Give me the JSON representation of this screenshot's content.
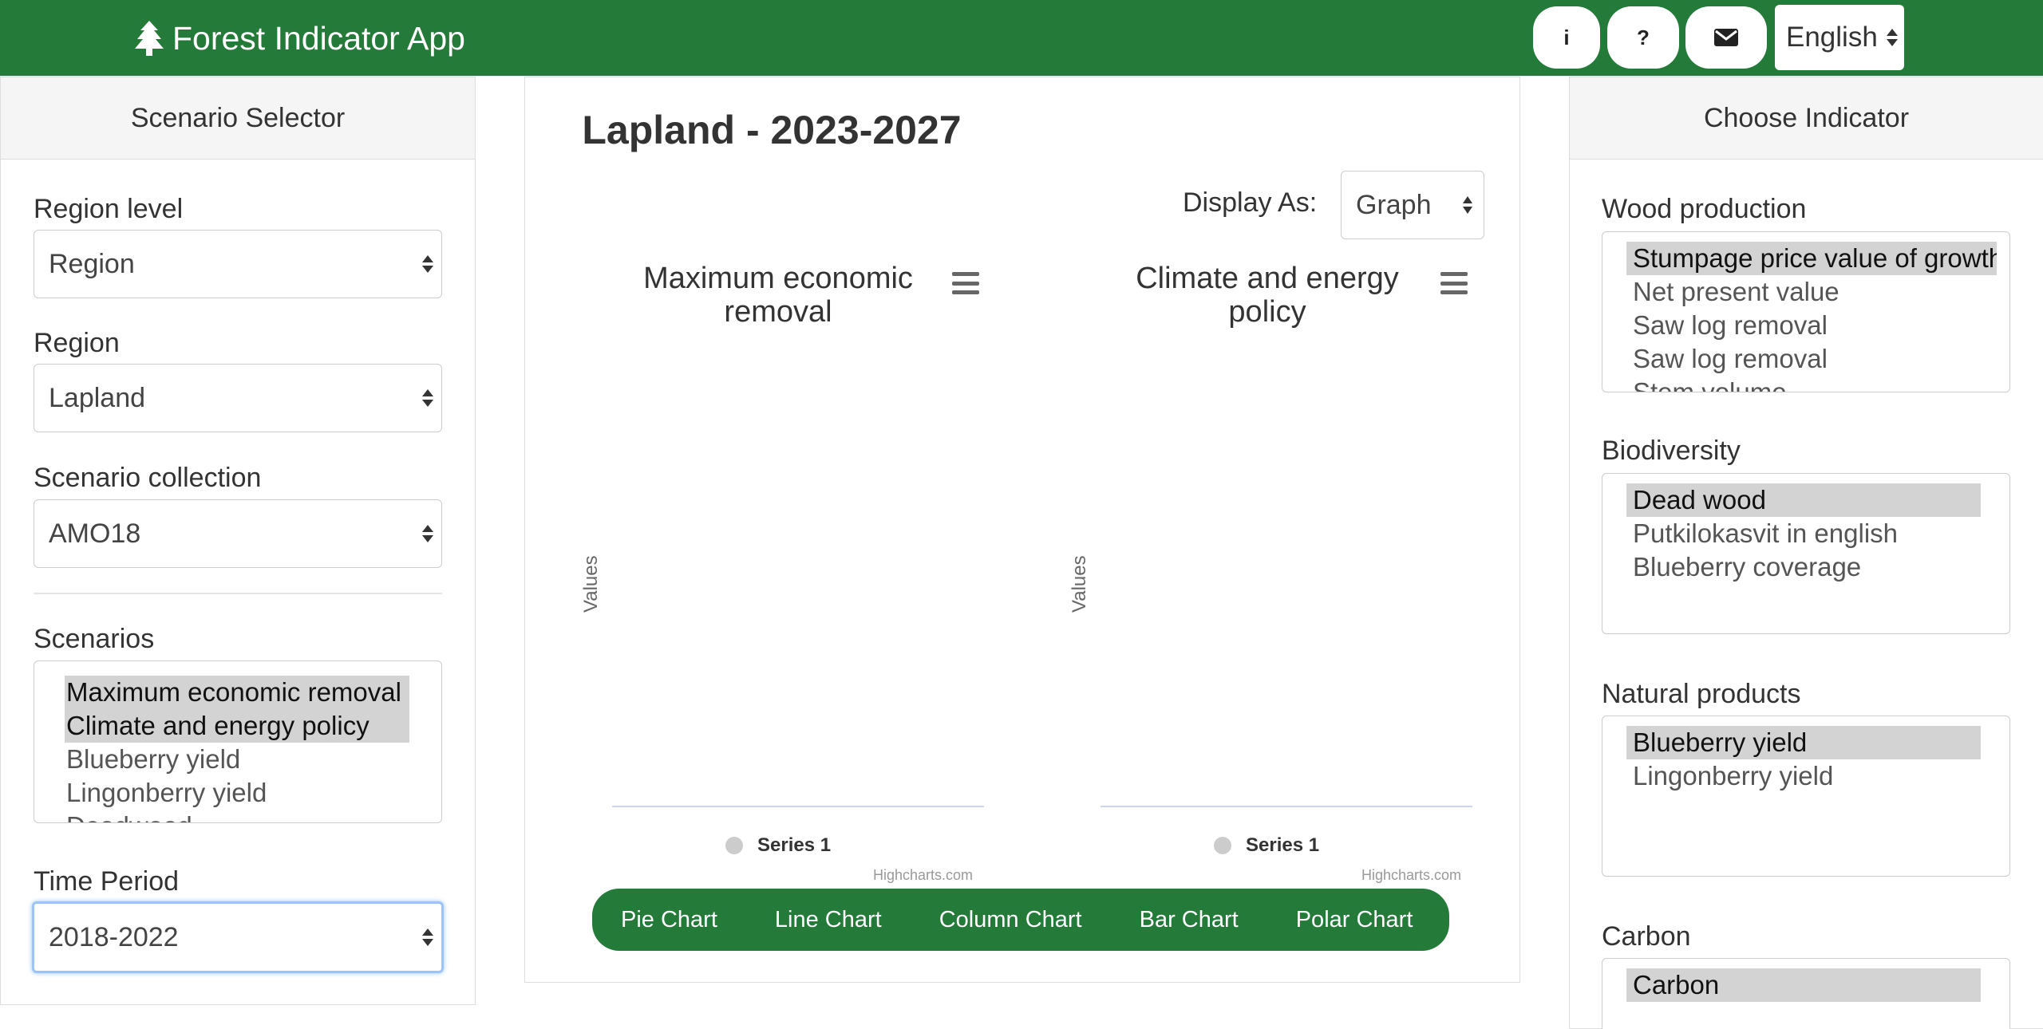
{
  "header": {
    "app_title": "Forest Indicator App",
    "brand_icon": "tree-icon",
    "info_label": "i",
    "help_label": "?",
    "contact_icon": "envelope-icon",
    "language": "English"
  },
  "scenario_selector": {
    "title": "Scenario Selector",
    "region_level_label": "Region level",
    "region_level_value": "Region",
    "region_label": "Region",
    "region_value": "Lapland",
    "collection_label": "Scenario collection",
    "collection_value": "AMO18",
    "scenarios_label": "Scenarios",
    "scenarios": [
      "Maximum economic removal",
      "Climate and energy policy",
      "Blueberry yield",
      "Lingonberry yield",
      "Deadwood"
    ],
    "time_period_label": "Time Period",
    "time_period_value": "2018-2022"
  },
  "main": {
    "title": "Lapland - 2023-2027",
    "display_as_label": "Display As:",
    "display_as_value": "Graph",
    "charts": [
      {
        "title_line1": "Maximum economic",
        "title_line2": "removal",
        "ylabel": "Values",
        "legend": "Series 1",
        "credit": "Highcharts.com"
      },
      {
        "title_line1": "Climate and energy",
        "title_line2": "policy",
        "ylabel": "Values",
        "legend": "Series 1",
        "credit": "Highcharts.com"
      }
    ],
    "chart_types": [
      "Pie Chart",
      "Line Chart",
      "Column Chart",
      "Bar Chart",
      "Polar Chart"
    ]
  },
  "indicators": {
    "title": "Choose Indicator",
    "groups": [
      {
        "label": "Wood production",
        "items": [
          "Stumpage price value of growth",
          "Net present value",
          "Saw log removal",
          "Saw log removal",
          "Stem volume"
        ]
      },
      {
        "label": "Biodiversity",
        "items": [
          "Dead wood",
          "Putkilokasvit in english",
          "Blueberry coverage"
        ]
      },
      {
        "label": "Natural products",
        "items": [
          "Blueberry yield",
          "Lingonberry yield"
        ]
      },
      {
        "label": "Carbon",
        "items": [
          "Carbon"
        ]
      }
    ]
  },
  "colors": {
    "brand_green": "#237a39",
    "selected_option": "#d3d3d3"
  }
}
